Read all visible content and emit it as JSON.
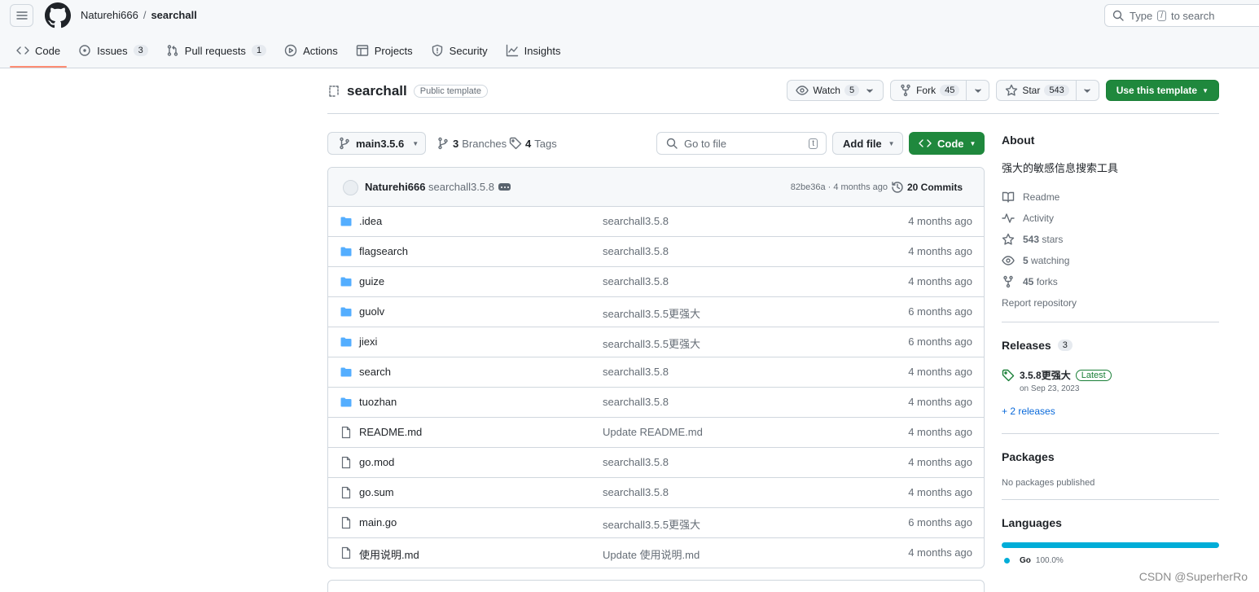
{
  "header": {
    "owner": "Naturehi666",
    "separator": "/",
    "repo": "searchall",
    "search_prefix": "Type",
    "search_key": "/",
    "search_suffix": "to search"
  },
  "tabs": [
    {
      "label": "Code",
      "count": "",
      "icon": "code-icon"
    },
    {
      "label": "Issues",
      "count": "3",
      "icon": "issue-icon"
    },
    {
      "label": "Pull requests",
      "count": "1",
      "icon": "pull-request-icon"
    },
    {
      "label": "Actions",
      "count": "",
      "icon": "play-icon"
    },
    {
      "label": "Projects",
      "count": "",
      "icon": "table-icon"
    },
    {
      "label": "Security",
      "count": "",
      "icon": "shield-icon"
    },
    {
      "label": "Insights",
      "count": "",
      "icon": "graph-icon"
    }
  ],
  "repo": {
    "name": "searchall",
    "visibility": "Public template",
    "watch_label": "Watch",
    "watch_count": "5",
    "fork_label": "Fork",
    "fork_count": "45",
    "star_label": "Star",
    "star_count": "543",
    "use_template_label": "Use this template"
  },
  "filenav": {
    "branch": "main3.5.6",
    "branches_count": "3",
    "branches_label": "Branches",
    "tags_count": "4",
    "tags_label": "Tags",
    "goto_placeholder": "Go to file",
    "goto_key": "t",
    "add_file_label": "Add file",
    "code_label": "Code"
  },
  "commit": {
    "author": "Naturehi666",
    "message": "searchall3.5.8",
    "hash_time": "82be36a · 4 months ago",
    "commits_label": "20 Commits"
  },
  "files": [
    {
      "type": "dir",
      "name": ".idea",
      "message": "searchall3.5.8",
      "date": "4 months ago"
    },
    {
      "type": "dir",
      "name": "flagsearch",
      "message": "searchall3.5.8",
      "date": "4 months ago"
    },
    {
      "type": "dir",
      "name": "guize",
      "message": "searchall3.5.8",
      "date": "4 months ago"
    },
    {
      "type": "dir",
      "name": "guolv",
      "message": "searchall3.5.5更强大",
      "date": "6 months ago"
    },
    {
      "type": "dir",
      "name": "jiexi",
      "message": "searchall3.5.5更强大",
      "date": "6 months ago"
    },
    {
      "type": "dir",
      "name": "search",
      "message": "searchall3.5.8",
      "date": "4 months ago"
    },
    {
      "type": "dir",
      "name": "tuozhan",
      "message": "searchall3.5.8",
      "date": "4 months ago"
    },
    {
      "type": "file",
      "name": "README.md",
      "message": "Update README.md",
      "date": "4 months ago"
    },
    {
      "type": "file",
      "name": "go.mod",
      "message": "searchall3.5.8",
      "date": "4 months ago"
    },
    {
      "type": "file",
      "name": "go.sum",
      "message": "searchall3.5.8",
      "date": "4 months ago"
    },
    {
      "type": "file",
      "name": "main.go",
      "message": "searchall3.5.5更强大",
      "date": "6 months ago"
    },
    {
      "type": "file",
      "name": "使用说明.md",
      "message": "Update 使用说明.md",
      "date": "4 months ago"
    }
  ],
  "sidebar": {
    "about_title": "About",
    "description": "强大的敏感信息搜索工具",
    "readme": "Readme",
    "activity": "Activity",
    "stars_count": "543",
    "stars_label": "stars",
    "watching_count": "5",
    "watching_label": "watching",
    "forks_count": "45",
    "forks_label": "forks",
    "report": "Report repository",
    "releases_title": "Releases",
    "releases_count": "3",
    "release_name": "3.5.8更强大",
    "release_badge": "Latest",
    "release_date": "on Sep 23, 2023",
    "more_releases": "+ 2 releases",
    "packages_title": "Packages",
    "packages_empty": "No packages published",
    "languages_title": "Languages",
    "language_name": "Go",
    "language_pct": "100.0%",
    "language_pct_value": 100,
    "language_color": "#00ADD8"
  },
  "watermark": "CSDN @SuperherRo",
  "colors": {
    "accent_green": "#1f883d",
    "tab_underline": "#fd8c73",
    "folder_blue": "#54aeff",
    "link_blue": "#0969da"
  }
}
